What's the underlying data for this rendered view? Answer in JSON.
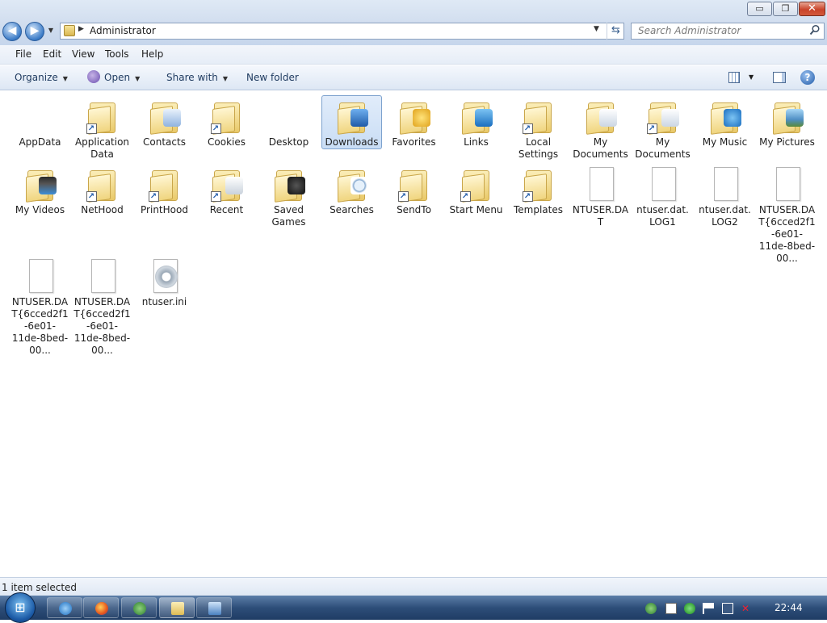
{
  "window": {
    "title_buttons": {
      "minimize": "▭",
      "maximize": "❐",
      "close": "✕"
    }
  },
  "nav": {
    "back_icon": "◀",
    "forward_icon": "▶",
    "address_path": "Administrator",
    "search_placeholder": "Search Administrator"
  },
  "menubar": {
    "items": [
      "File",
      "Edit",
      "View",
      "Tools",
      "Help"
    ]
  },
  "toolbar": {
    "organize": "Organize",
    "open": "Open",
    "share_with": "Share with",
    "new_folder": "New folder",
    "help": "?"
  },
  "files": [
    {
      "name": "AppData",
      "kind": "plain"
    },
    {
      "name": "Application Data",
      "kind": "folder-shortcut"
    },
    {
      "name": "Contacts",
      "kind": "folder-contacts"
    },
    {
      "name": "Cookies",
      "kind": "folder-shortcut"
    },
    {
      "name": "Desktop",
      "kind": "plain"
    },
    {
      "name": "Downloads",
      "kind": "folder-downloads",
      "selected": true
    },
    {
      "name": "Favorites",
      "kind": "folder-favorites"
    },
    {
      "name": "Links",
      "kind": "folder-links"
    },
    {
      "name": "Local Settings",
      "kind": "folder-shortcut"
    },
    {
      "name": "My Documents",
      "kind": "folder-docs"
    },
    {
      "name": "My Documents",
      "kind": "folder-docs-shortcut"
    },
    {
      "name": "My Music",
      "kind": "folder-music"
    },
    {
      "name": "My Pictures",
      "kind": "folder-pictures"
    },
    {
      "name": "My Videos",
      "kind": "folder-videos"
    },
    {
      "name": "NetHood",
      "kind": "folder-shortcut"
    },
    {
      "name": "PrintHood",
      "kind": "folder-shortcut"
    },
    {
      "name": "Recent",
      "kind": "folder-recent-shortcut"
    },
    {
      "name": "Saved Games",
      "kind": "folder-games"
    },
    {
      "name": "Searches",
      "kind": "folder-searches"
    },
    {
      "name": "SendTo",
      "kind": "folder-shortcut"
    },
    {
      "name": "Start Menu",
      "kind": "folder-shortcut"
    },
    {
      "name": "Templates",
      "kind": "folder-shortcut"
    },
    {
      "name": "NTUSER.DAT",
      "kind": "file"
    },
    {
      "name": "ntuser.dat.LOG1",
      "kind": "file"
    },
    {
      "name": "ntuser.dat.LOG2",
      "kind": "file"
    },
    {
      "name": "NTUSER.DAT{6cced2f1-6e01-11de-8bed-00...",
      "kind": "file"
    },
    {
      "name": "NTUSER.DAT{6cced2f1-6e01-11de-8bed-00...",
      "kind": "file"
    },
    {
      "name": "NTUSER.DAT{6cced2f1-6e01-11de-8bed-00...",
      "kind": "file"
    },
    {
      "name": "ntuser.ini",
      "kind": "settings-file"
    }
  ],
  "status": {
    "text": "1 item selected"
  },
  "taskbar": {
    "start_icon": "⊞",
    "clock": "22:44"
  }
}
